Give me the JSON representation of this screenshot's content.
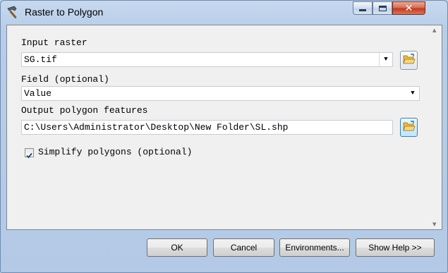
{
  "window": {
    "title": "Raster to Polygon",
    "app_icon": "hammer-icon",
    "controls": {
      "minimize": "minimize-icon",
      "maximize": "maximize-icon",
      "close": "close-icon",
      "close_glyph": "✕"
    }
  },
  "form": {
    "input_raster": {
      "label": "Input raster",
      "value": "SG.tif",
      "browse_icon": "folder-open-icon"
    },
    "field": {
      "label": "Field (optional)",
      "value": "Value"
    },
    "output_polygon": {
      "label": "Output polygon features",
      "value": "C:\\Users\\Administrator\\Desktop\\New Folder\\SL.shp",
      "browse_icon": "folder-open-icon"
    },
    "simplify": {
      "label": "Simplify polygons (optional)",
      "checked": true
    }
  },
  "buttons": {
    "ok": "OK",
    "cancel": "Cancel",
    "environments": "Environments...",
    "show_help": "Show Help >>"
  },
  "colors": {
    "frame": "#b7cde8",
    "client": "#f0f0f0",
    "close_button": "#c0391c",
    "active_border": "#3c7fb1"
  }
}
